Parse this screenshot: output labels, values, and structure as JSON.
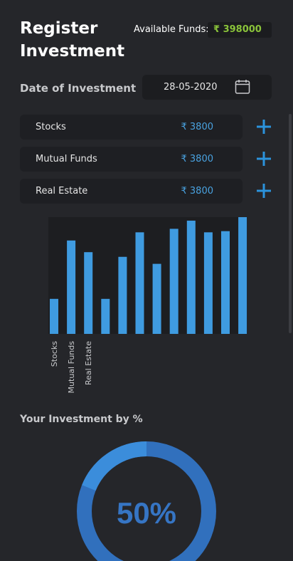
{
  "header": {
    "title_line1": "Register",
    "title_line2": "Investment",
    "funds_label": "Available Funds:",
    "funds_value": "₹ 398000",
    "funds_color": "#8ac33a"
  },
  "date": {
    "label": "Date of Investment",
    "value": "28-05-2020",
    "icon": "calendar-icon"
  },
  "investments": [
    {
      "label": "Stocks",
      "amount": "₹ 3800"
    },
    {
      "label": "Mutual Funds",
      "amount": "₹ 3800"
    },
    {
      "label": "Real Estate",
      "amount": "₹ 3800"
    }
  ],
  "add_icon": "plus-icon",
  "accent_color": "#3f9be0",
  "chart_data": {
    "type": "bar",
    "categories": [
      "Stocks",
      "Mutual Funds",
      "Real Estate",
      "",
      "",
      "",
      "",
      "",
      "",
      "",
      "",
      ""
    ],
    "values": [
      30,
      80,
      70,
      30,
      66,
      87,
      60,
      90,
      97,
      87,
      88,
      100
    ],
    "ylim": [
      0,
      100
    ],
    "bar_color": "#3f9be0",
    "grid": false
  },
  "section_title": "Your Investment by %",
  "donut": {
    "percent_label": "50%",
    "value": 50,
    "color": "#3a7fcf"
  }
}
